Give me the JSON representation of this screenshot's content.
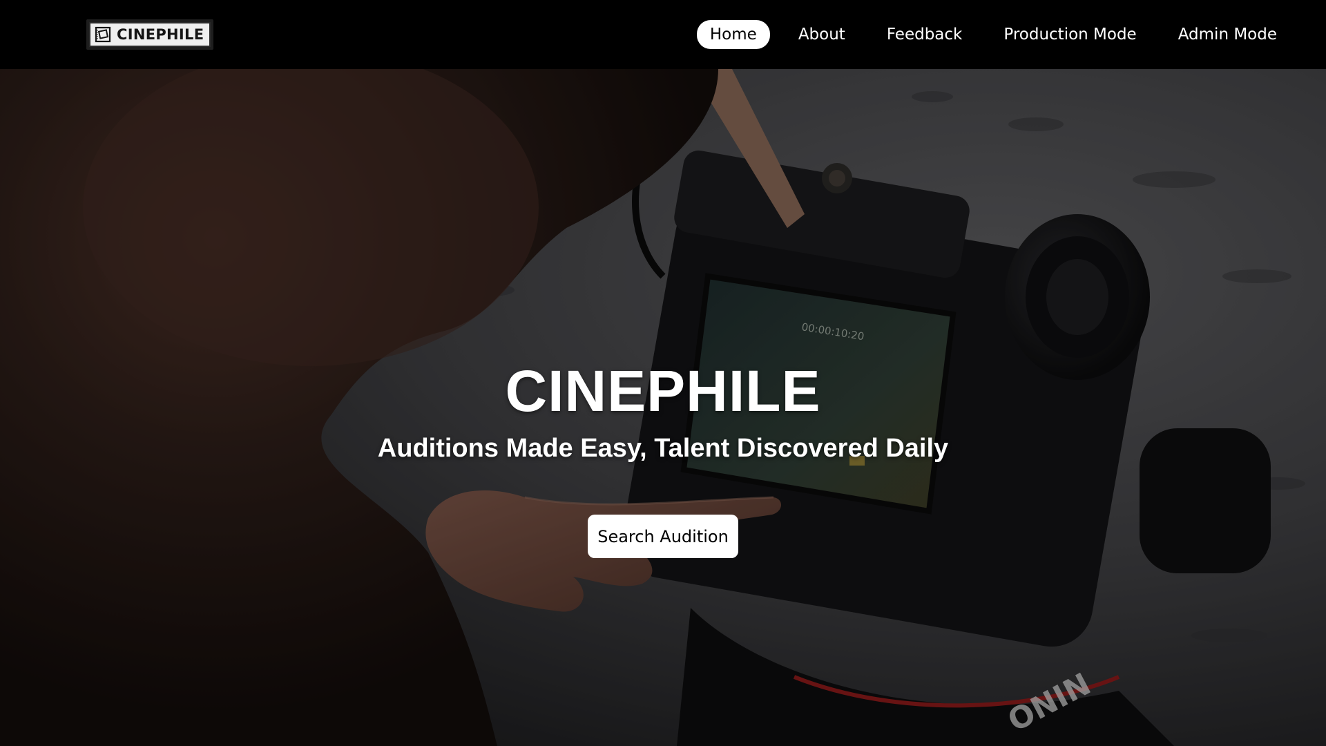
{
  "brand": {
    "logo_text": "CINEPHILE",
    "logo_icon": "film-frame-icon"
  },
  "nav": {
    "items": [
      {
        "label": "Home",
        "active": true
      },
      {
        "label": "About",
        "active": false
      },
      {
        "label": "Feedback",
        "active": false
      },
      {
        "label": "Production Mode",
        "active": false
      },
      {
        "label": "Admin Mode",
        "active": false
      }
    ]
  },
  "hero": {
    "title": "CINEPHILE",
    "subtitle": "Auditions Made Easy, Talent Discovered Daily",
    "cta_label": "Search Audition",
    "background_image": "camera-operator-photo"
  },
  "colors": {
    "navbar_bg": "#000000",
    "active_pill_bg": "#ffffff",
    "text_light": "#ffffff",
    "button_bg": "#ffffff",
    "button_text": "#000000"
  }
}
